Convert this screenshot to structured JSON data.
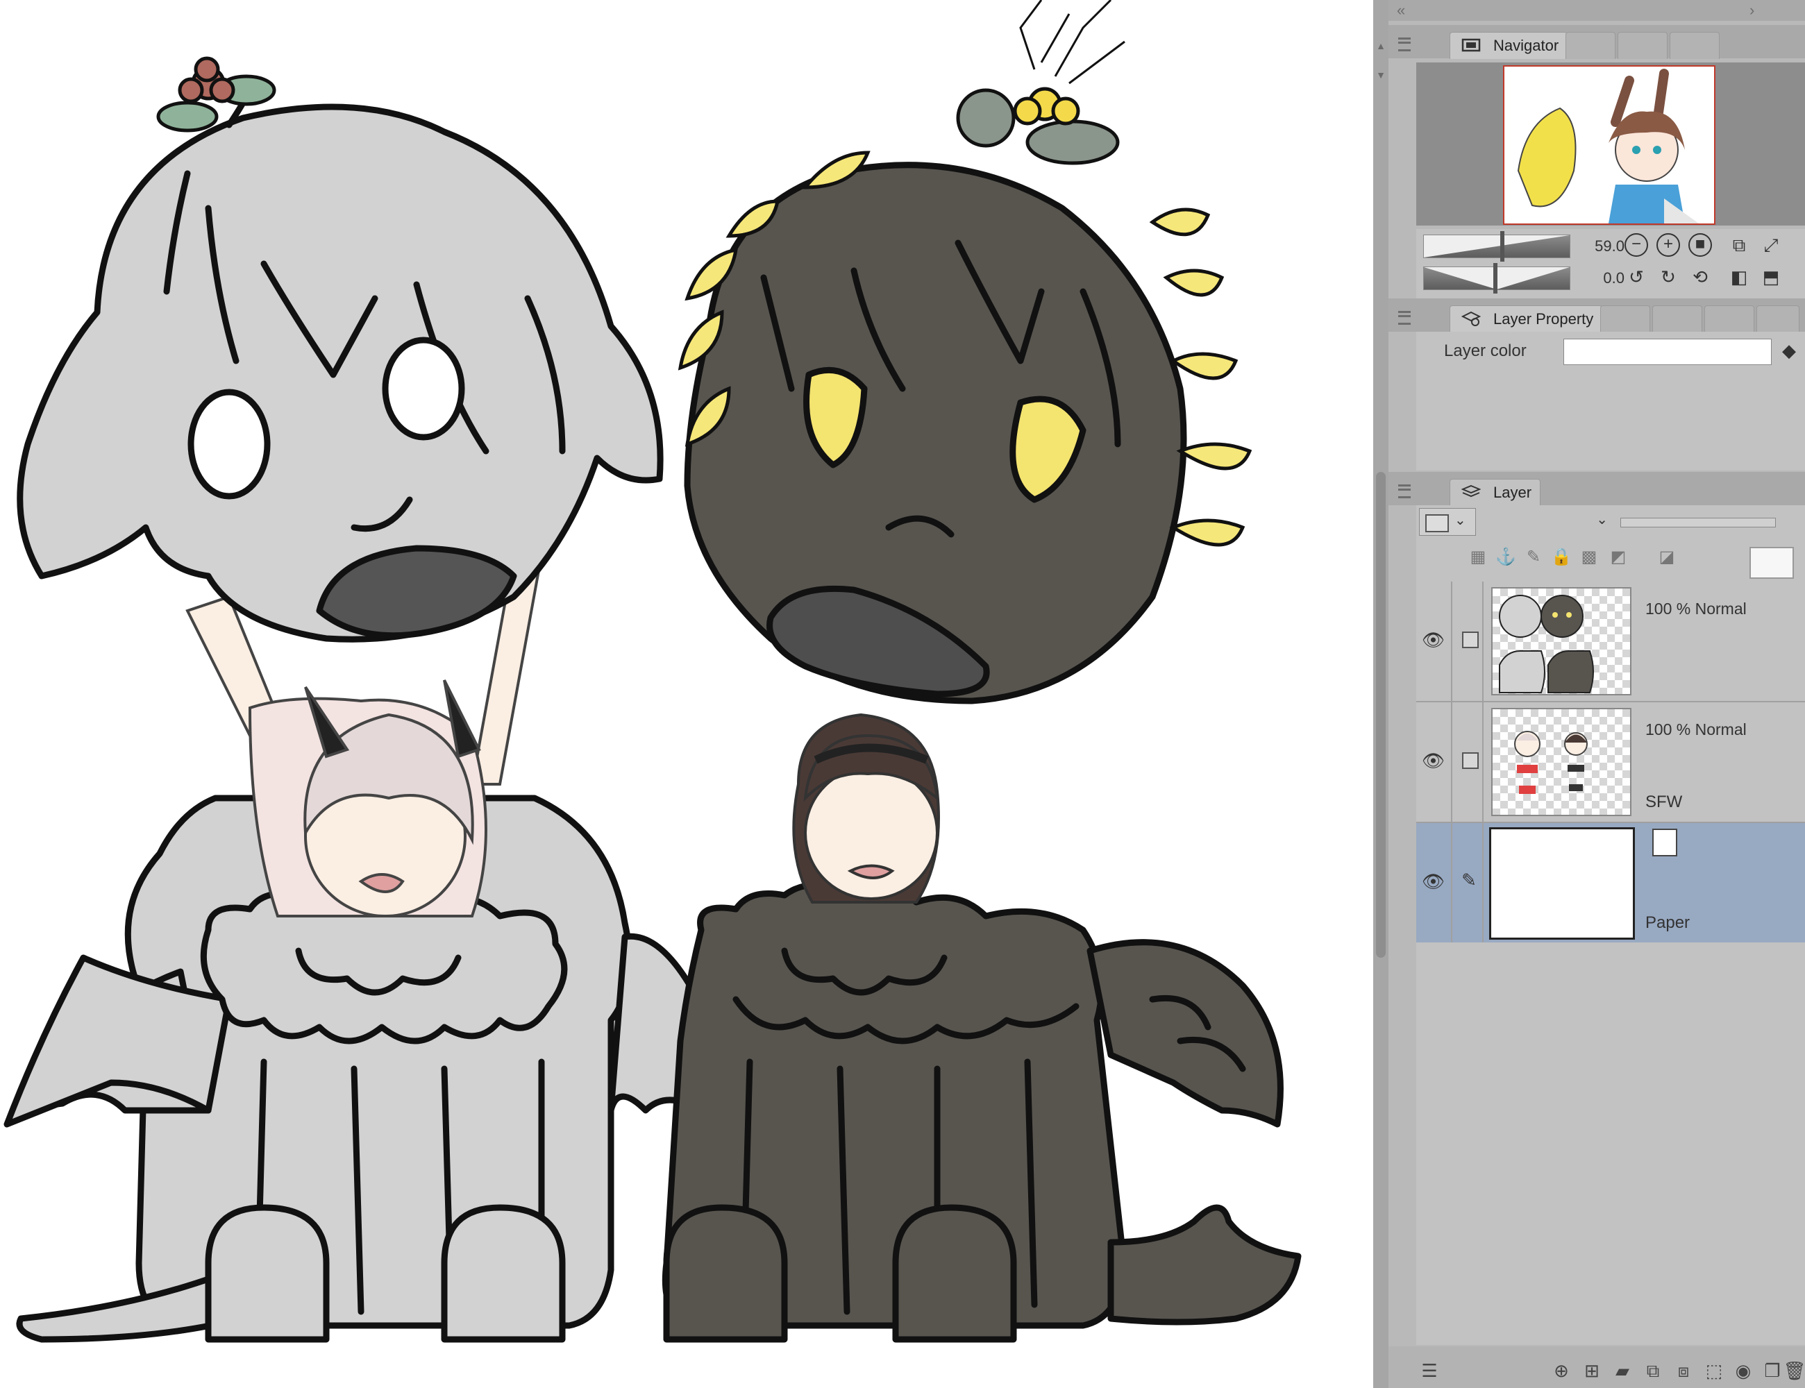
{
  "navigator": {
    "tab_label": "Navigator",
    "zoom_value": "59.0",
    "rotation_value": "0.0"
  },
  "layer_property": {
    "tab_label": "Layer Property",
    "layer_color_label": "Layer color",
    "layer_color_value": "#ffffff"
  },
  "layer_panel": {
    "tab_label": "Layer",
    "layers": [
      {
        "mode": "100 % Normal",
        "name": ""
      },
      {
        "mode": "100 % Normal",
        "name": "SFW"
      },
      {
        "mode": "",
        "name": "Paper"
      }
    ]
  },
  "colors": {
    "dock_bg": "#b9b9b9",
    "panel_bg": "#c2c2c2",
    "selected_layer": "#98a9c2",
    "grey_creature": "#d2d2d2",
    "dark_creature": "#58554f",
    "laurel_yellow": "#f6e77a",
    "flower_red": "#b06a5f",
    "leaf_green": "#8fb39a"
  },
  "icons": {
    "visibility": "eye-icon",
    "edit": "pencil-icon",
    "zoom_out": "minus-circle-icon",
    "zoom_in": "plus-circle-icon",
    "fit": "stop-icon",
    "rotate_left": "rotate-left-icon",
    "rotate_right": "rotate-right-icon",
    "reset_rotation": "reset-icon",
    "flip_h": "flip-horizontal-icon",
    "flip_v": "flip-vertical-icon"
  }
}
